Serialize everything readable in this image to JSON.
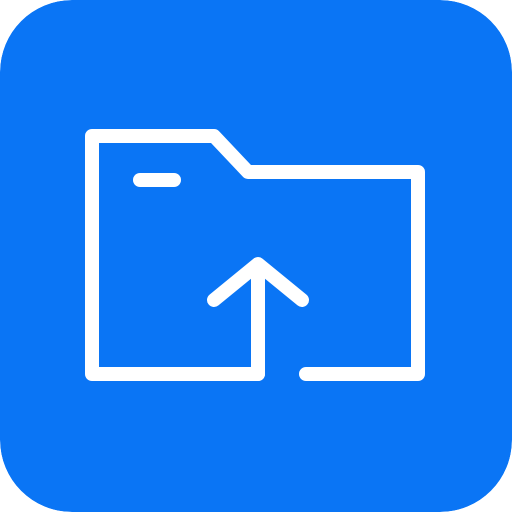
{
  "icon": {
    "name": "folder-upload-icon",
    "tile_color": "#0A75F5",
    "stroke_color": "#FFFFFF"
  }
}
